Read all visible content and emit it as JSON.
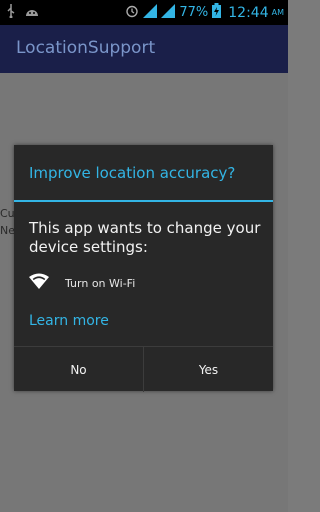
{
  "status_bar": {
    "battery_percent": "77%",
    "time": "12:44",
    "ampm": "AM",
    "icons_left": [
      "usb-icon",
      "android-icon"
    ],
    "icons_right": [
      "alarm-icon",
      "wifi-signal-icon",
      "cell-signal-icon",
      "battery-charging-icon"
    ]
  },
  "app": {
    "title": "LocationSupport"
  },
  "background": {
    "line1": "Cu",
    "line2": "Ne"
  },
  "dialog": {
    "title": "Improve location accuracy?",
    "message": "This app wants to change your device settings:",
    "wifi_label": "Turn on Wi-Fi",
    "learn_more": "Learn more",
    "no_label": "No",
    "yes_label": "Yes"
  },
  "colors": {
    "accent": "#33b5e5",
    "action_bar": "#1a1f49",
    "dialog_bg": "#282828"
  }
}
